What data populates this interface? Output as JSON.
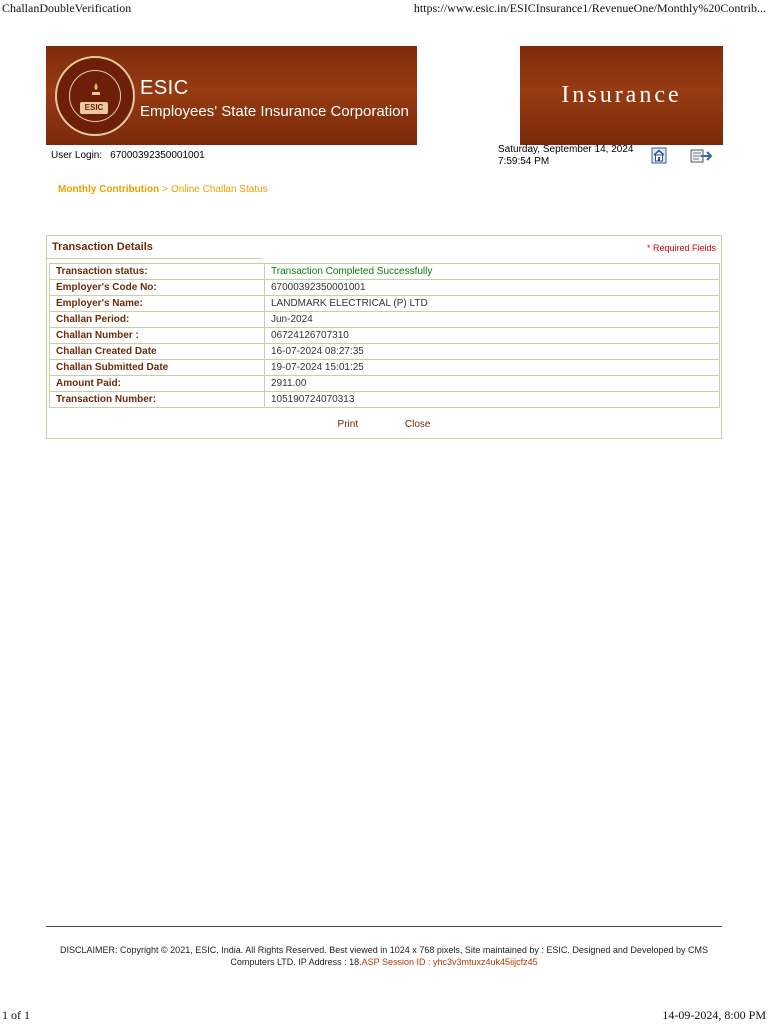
{
  "print_header": {
    "title": "ChallanDoubleVerification",
    "url": "https://www.esic.in/ESICInsurance1/RevenueOne/Monthly%20Contrib..."
  },
  "banner": {
    "short_name": "ESIC",
    "full_name": "Employees' State Insurance Corporation",
    "logo_tag": "ESIC",
    "right_word": "Insurance",
    "color": "#8a3410"
  },
  "user": {
    "label": "User Login:",
    "value": "67000392350001001"
  },
  "datetime": {
    "date": "Saturday, September 14, 2024",
    "time": "7:59:54 PM"
  },
  "icons": {
    "home": "home-icon",
    "logout": "logout-icon"
  },
  "breadcrumb": {
    "parent": "Monthly Contribution",
    "separator": ">",
    "current": "Online Challan Status"
  },
  "panel": {
    "title": "Transaction Details",
    "required_note": "* Required Fields",
    "rows": [
      {
        "label": "Transaction status:",
        "value": "Transaction Completed Successfully"
      },
      {
        "label": "Employer's Code No:",
        "value": "67000392350001001"
      },
      {
        "label": "Employer's Name:",
        "value": "LANDMARK ELECTRICAL (P) LTD"
      },
      {
        "label": "Challan Period:",
        "value": "Jun-2024"
      },
      {
        "label": "Challan Number :",
        "value": "06724126707310"
      },
      {
        "label": "Challan Created Date",
        "value": "16-07-2024 08:27:35"
      },
      {
        "label": "Challan Submitted Date",
        "value": "19-07-2024 15:01:25"
      },
      {
        "label": "Amount Paid:",
        "value": "2911.00"
      },
      {
        "label": "Transaction Number:",
        "value": "105190724070313"
      }
    ],
    "print_label": "Print",
    "close_label": "Close"
  },
  "disclaimer": {
    "text": "DISCLAIMER: Copyright © 2021, ESIC, India. All Rights Reserved. Best viewed in 1024 x 768 pixels, Site maintained by : ESIC. Designed and Developed by CMS Computers LTD. IP Address : 18.",
    "session": "ASP Session ID : yhc3v3mtuxz4uk45iijcfz45"
  },
  "print_footer": {
    "page": "1 of 1",
    "timestamp": "14-09-2024, 8:00 PM"
  },
  "colors": {
    "accent_text": "#6b2c0c",
    "breadcrumb": "#e8a200",
    "success": "#0a7d0a",
    "required": "#e00000"
  }
}
